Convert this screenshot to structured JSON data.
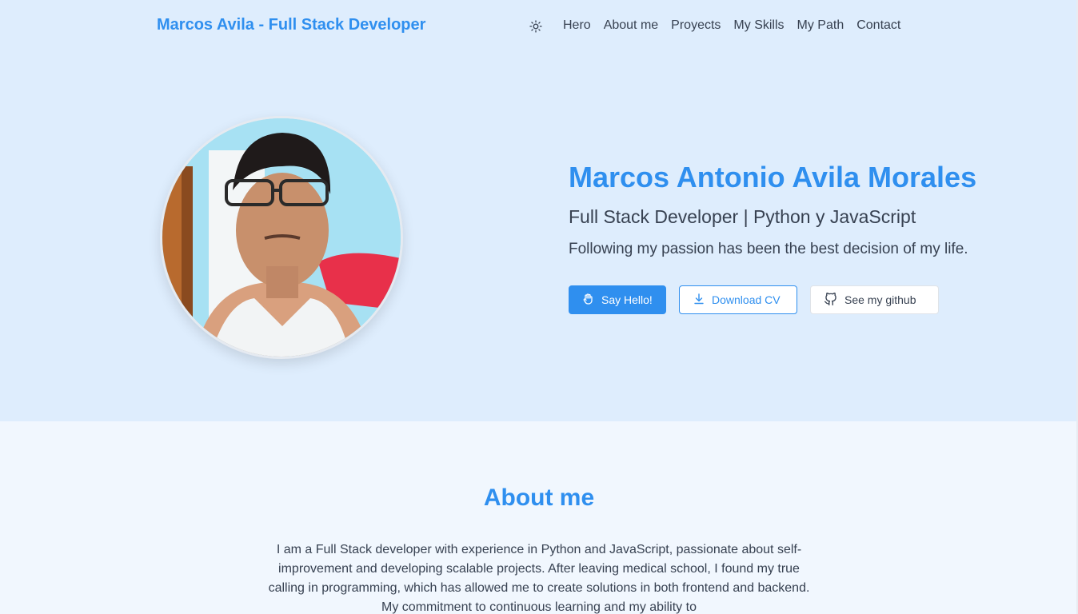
{
  "nav": {
    "brand": "Marcos Avila - Full Stack Developer",
    "theme_icon": "sun-icon",
    "links": [
      "Hero",
      "About me",
      "Proyects",
      "My Skills",
      "My Path",
      "Contact"
    ]
  },
  "hero": {
    "photo_icon": "profile-photo",
    "name": "Marcos Antonio Avila Morales",
    "role": "Full Stack Developer | Python y JavaScript",
    "tagline": "Following my passion has been the best decision of my life.",
    "buttons": {
      "say_hello": "Say Hello!",
      "say_hello_icon": "waving-hand-icon",
      "download_cv": "Download CV",
      "download_icon": "download-icon",
      "github": "See my github",
      "github_icon": "github-icon"
    }
  },
  "about": {
    "title": "About me",
    "body": "I am a Full Stack developer with experience in Python and JavaScript, passionate about self-improvement and developing scalable projects. After leaving medical school, I found my true calling in programming, which has allowed me to create solutions in both frontend and backend. My commitment to continuous learning and my ability to"
  },
  "colors": {
    "accent": "#2f8fef",
    "hero_bg": "#deedfd",
    "page_bg": "#f1f7fe",
    "text": "#374151"
  }
}
